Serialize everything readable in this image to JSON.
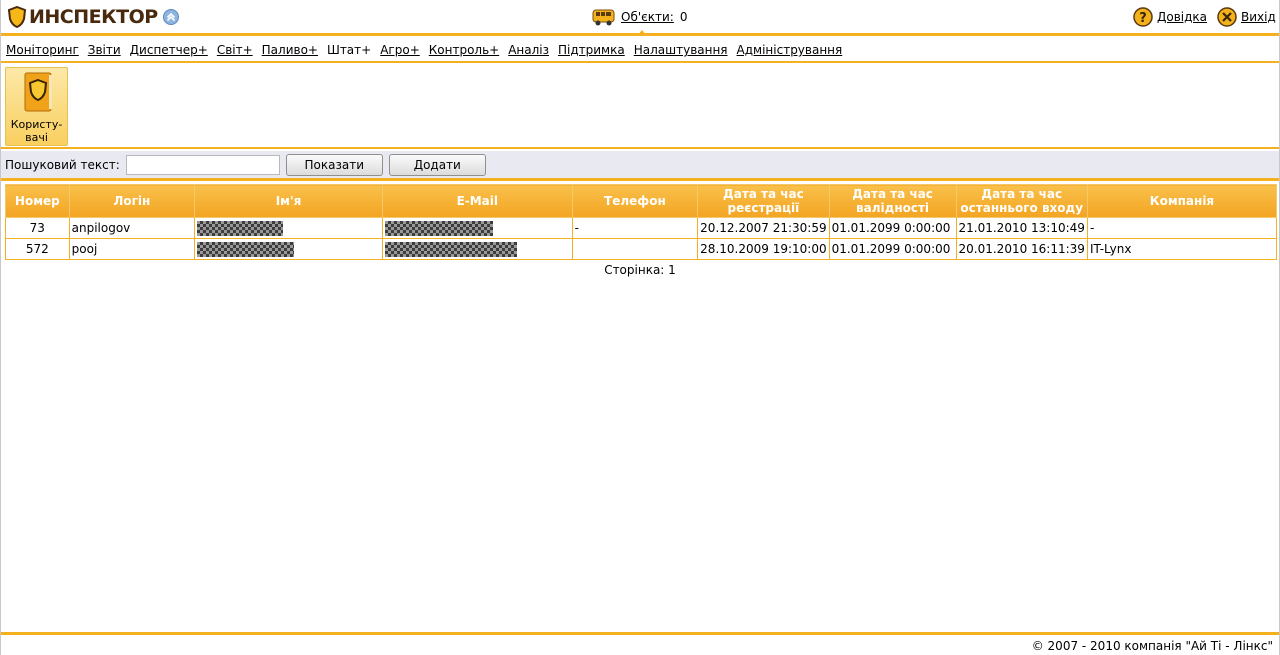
{
  "header": {
    "logo_text": "ИНСПЕКТОР",
    "objects_label": "Об'єкти:",
    "objects_count": "0",
    "help_label": "Довідка",
    "exit_label": "Вихід"
  },
  "menu": [
    {
      "label": "Моніторинг"
    },
    {
      "label": "Звіти"
    },
    {
      "label": "Диспетчер+"
    },
    {
      "label": "Світ+"
    },
    {
      "label": "Паливо+"
    },
    {
      "label": "Штат+"
    },
    {
      "label": "Агро+"
    },
    {
      "label": "Контроль+"
    },
    {
      "label": "Аналіз"
    },
    {
      "label": "Підтримка"
    },
    {
      "label": "Налаштування"
    },
    {
      "label": "Адміністрування"
    }
  ],
  "tile": {
    "line1": "Користу-",
    "line2": "вачі"
  },
  "search": {
    "label": "Пошуковий текст:",
    "value": "",
    "show_button": "Показати",
    "add_button": "Додати"
  },
  "table": {
    "columns": [
      "Номер",
      "Логін",
      "Ім'я",
      "E-Mail",
      "Телефон",
      "Дата та час реєстрації",
      "Дата та час валідності",
      "Дата та час останнього входу",
      "Компанія"
    ],
    "rows": [
      {
        "number": "73",
        "login": "anpilogov",
        "phone": "-",
        "registered": "20.12.2007 21:30:59",
        "valid": "01.01.2099 0:00:00",
        "last_login": "21.01.2010 13:10:49",
        "company": "-"
      },
      {
        "number": "572",
        "login": "pooj",
        "phone": "",
        "registered": "28.10.2009 19:10:00",
        "valid": "01.01.2099 0:00:00",
        "last_login": "20.01.2010 16:11:39",
        "company": "IT-Lynx"
      }
    ]
  },
  "pager": {
    "text": "Сторінка: 1"
  },
  "footer": {
    "copyright": "© 2007 - 2010 компанія \"Ай Ті - Лінкс\""
  },
  "colors": {
    "accent": "#f4b01e",
    "header_grad_top": "#f9c04a",
    "header_grad_bottom": "#f3a422",
    "toolbar_bg": "#e9e9f1"
  }
}
